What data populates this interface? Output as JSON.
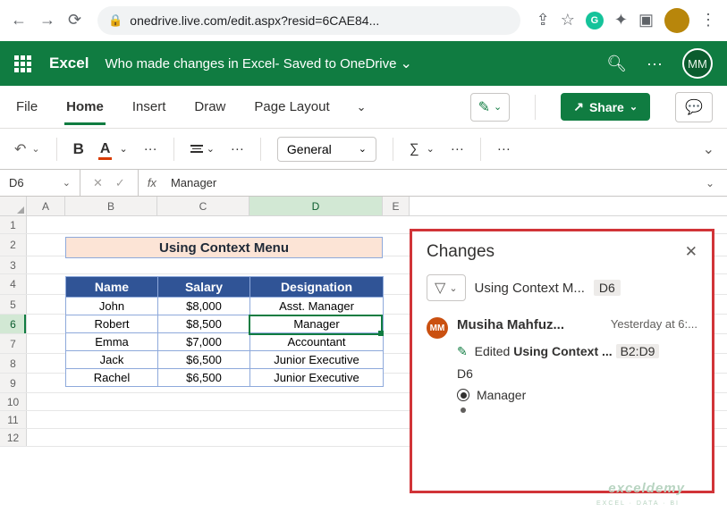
{
  "browser": {
    "url": "onedrive.live.com/edit.aspx?resid=6CAE84..."
  },
  "header": {
    "app": "Excel",
    "doc_title": "Who made changes in Excel",
    "saved": " -  Saved to OneDrive",
    "avatar": "MM"
  },
  "tabs": {
    "file": "File",
    "home": "Home",
    "insert": "Insert",
    "draw": "Draw",
    "page_layout": "Page Layout",
    "share": "Share"
  },
  "ribbon": {
    "format": "General"
  },
  "formula": {
    "ref": "D6",
    "fx": "fx",
    "val": "Manager"
  },
  "columns": [
    "A",
    "B",
    "C",
    "D",
    "E"
  ],
  "rows": [
    "1",
    "2",
    "3",
    "4",
    "5",
    "6",
    "7",
    "8",
    "9",
    "10",
    "11",
    "12"
  ],
  "sheet_title": "Using Context Menu",
  "th": {
    "name": "Name",
    "salary": "Salary",
    "des": "Designation"
  },
  "tbl": [
    {
      "n": "John",
      "s": "$8,000",
      "d": "Asst. Manager"
    },
    {
      "n": "Robert",
      "s": "$8,500",
      "d": "Manager"
    },
    {
      "n": "Emma",
      "s": "$7,000",
      "d": "Accountant"
    },
    {
      "n": "Jack",
      "s": "$6,500",
      "d": "Junior Executive"
    },
    {
      "n": "Rachel",
      "s": "$6,500",
      "d": "Junior Executive"
    }
  ],
  "changes": {
    "title": "Changes",
    "filter_sheet": "Using Context M...",
    "filter_cell": "D6",
    "user": "Musiha Mahfuz...",
    "time": "Yesterday at 6:...",
    "action": "Edited",
    "range_sheet": "Using Context ...",
    "range": "B2:D9",
    "cell": "D6",
    "new_val": "Manager"
  },
  "watermark": {
    "t": "exceldemy",
    "s": "EXCEL · DATA · BI"
  }
}
